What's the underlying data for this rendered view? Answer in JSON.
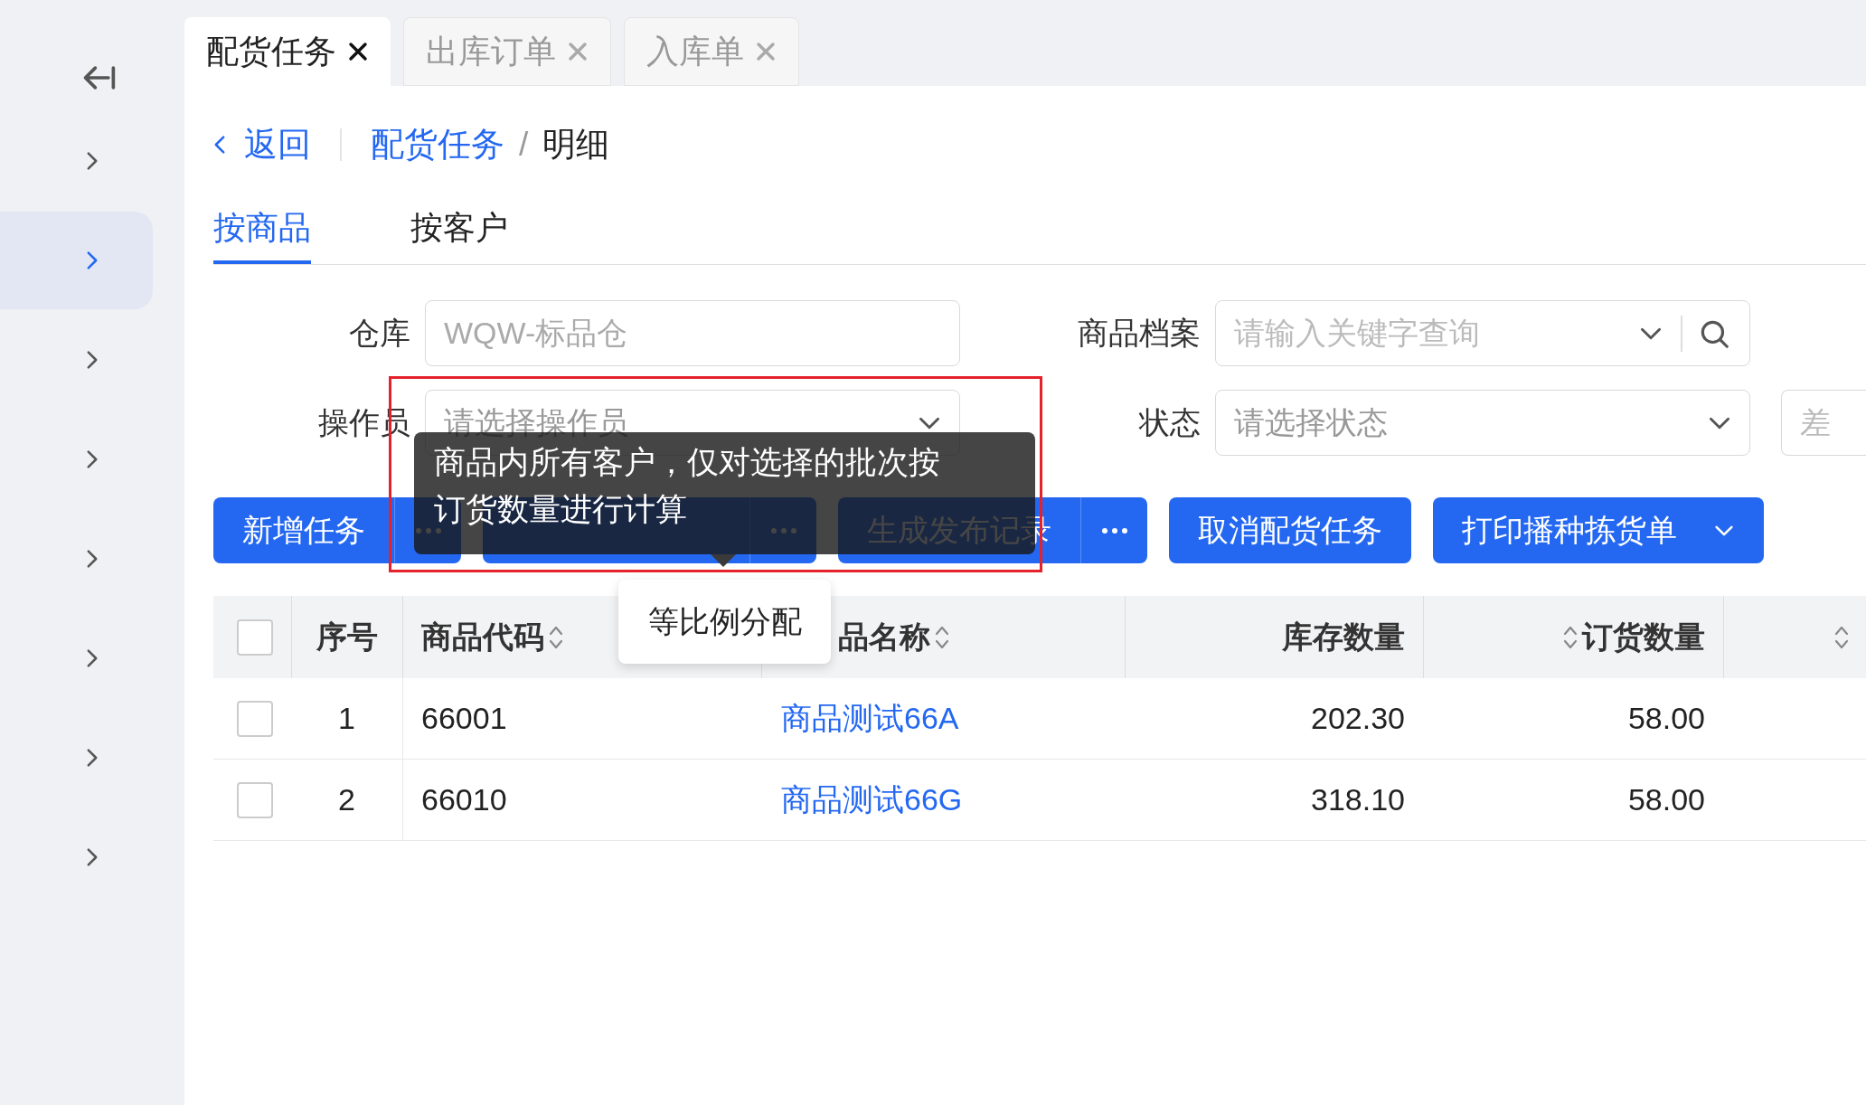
{
  "sidebar": {
    "items": [
      {
        "selected": false
      },
      {
        "selected": true
      },
      {
        "selected": false
      },
      {
        "selected": false
      },
      {
        "selected": false
      },
      {
        "selected": false
      },
      {
        "selected": false
      },
      {
        "selected": false
      }
    ]
  },
  "tabs": [
    {
      "label": "配货任务",
      "selected": true
    },
    {
      "label": "出库订单",
      "selected": false
    },
    {
      "label": "入库单",
      "selected": false
    }
  ],
  "breadcrumb": {
    "back": "返回",
    "parent": "配货任务",
    "separator": "/",
    "current": "明细"
  },
  "view_tabs": [
    {
      "label": "按商品",
      "selected": true
    },
    {
      "label": "按客户",
      "selected": false
    }
  ],
  "filters": [
    {
      "kind": "text",
      "label": "仓库",
      "value": "WQW-标品仓",
      "disabled": true
    },
    {
      "kind": "search",
      "label": "商品档案",
      "placeholder": "请输入关键字查询"
    },
    {
      "kind": "select",
      "label": "操作员",
      "placeholder": "请选择操作员"
    },
    {
      "kind": "select",
      "label": "状态",
      "placeholder": "请选择状态"
    },
    {
      "kind": "cut",
      "placeholder": "差"
    }
  ],
  "actions": [
    {
      "kind": "split",
      "label": "新增任务"
    },
    {
      "kind": "split"
    },
    {
      "kind": "split",
      "label": "生成发布记录"
    },
    {
      "kind": "button",
      "label": "取消配货任务"
    },
    {
      "kind": "dropdown",
      "label": "打印播种拣货单"
    }
  ],
  "tooltip": {
    "lines": [
      "商品内所有客户，仅对选择的批次按",
      "订货数量进行计算"
    ]
  },
  "menu": {
    "items": [
      {
        "label": "等比例分配"
      }
    ]
  },
  "table": {
    "all_selected": false,
    "columns": [
      {
        "label": "序号",
        "sortable": false
      },
      {
        "label": "商品代码",
        "sortable": true
      },
      {
        "label": "品名称",
        "sortable": true
      },
      {
        "label": "库存数量",
        "sortable": false
      },
      {
        "label": "订货数量",
        "sortable": true
      },
      {
        "sortable": true
      }
    ],
    "rows": [
      {
        "selected": false,
        "cells": [
          "1",
          "66001",
          "商品测试66A",
          "202.30",
          "58.00"
        ]
      },
      {
        "selected": false,
        "cells": [
          "2",
          "66010",
          "商品测试66G",
          "318.10",
          "58.00"
        ]
      }
    ]
  }
}
